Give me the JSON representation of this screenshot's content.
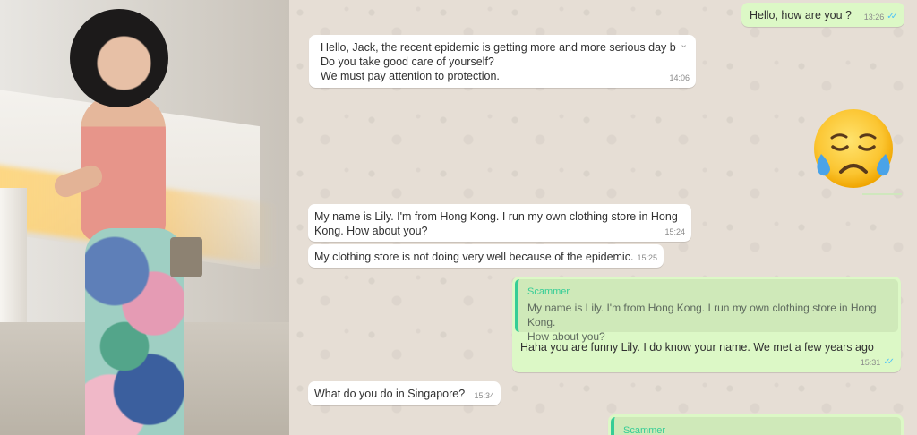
{
  "chat": {
    "messages": [
      {
        "id": "m1",
        "dir": "out",
        "text": "Hello, how are you ?",
        "time": "13:26",
        "ticks": "✓✓"
      },
      {
        "id": "m2",
        "dir": "in",
        "text": "Hello, Jack, the recent epidemic is getting more and more serious day by day\nDo you take good care of yourself?\nWe must pay attention to protection.",
        "time": "14:06"
      },
      {
        "id": "m3",
        "dir": "out",
        "sticker": "crying-face-emoji"
      },
      {
        "id": "m4",
        "dir": "in",
        "text": "My name is Lily. I'm from Hong Kong. I run my own clothing store in Hong\nKong. How about you?",
        "time": "15:24"
      },
      {
        "id": "m5",
        "dir": "in",
        "text": "My clothing store is not doing very well because of the epidemic.",
        "time": "15:25"
      },
      {
        "id": "m6",
        "dir": "out",
        "quote_author": "Scammer",
        "quote_text": "My name is Lily. I'm from Hong Kong. I run my own clothing store in Hong Kong.\nHow about you?",
        "text": "Haha you are funny Lily. I do know your name. We met a few years ago",
        "time": "15:31",
        "ticks": "✓✓"
      },
      {
        "id": "m7",
        "dir": "in",
        "text": "What do you do in Singapore?",
        "time": "15:34"
      },
      {
        "id": "m8",
        "dir": "out",
        "quote_author": "Scammer"
      }
    ]
  },
  "colors": {
    "chat_bg": "#e6ded5",
    "incoming": "#ffffff",
    "outgoing": "#dcf8c6",
    "quote_accent": "#35cd96",
    "read_ticks": "#4fc3f7"
  },
  "icons": {
    "message_menu": "chevron-down-icon",
    "read_receipt": "double-check-icon",
    "sticker": "crying-face-emoji"
  }
}
